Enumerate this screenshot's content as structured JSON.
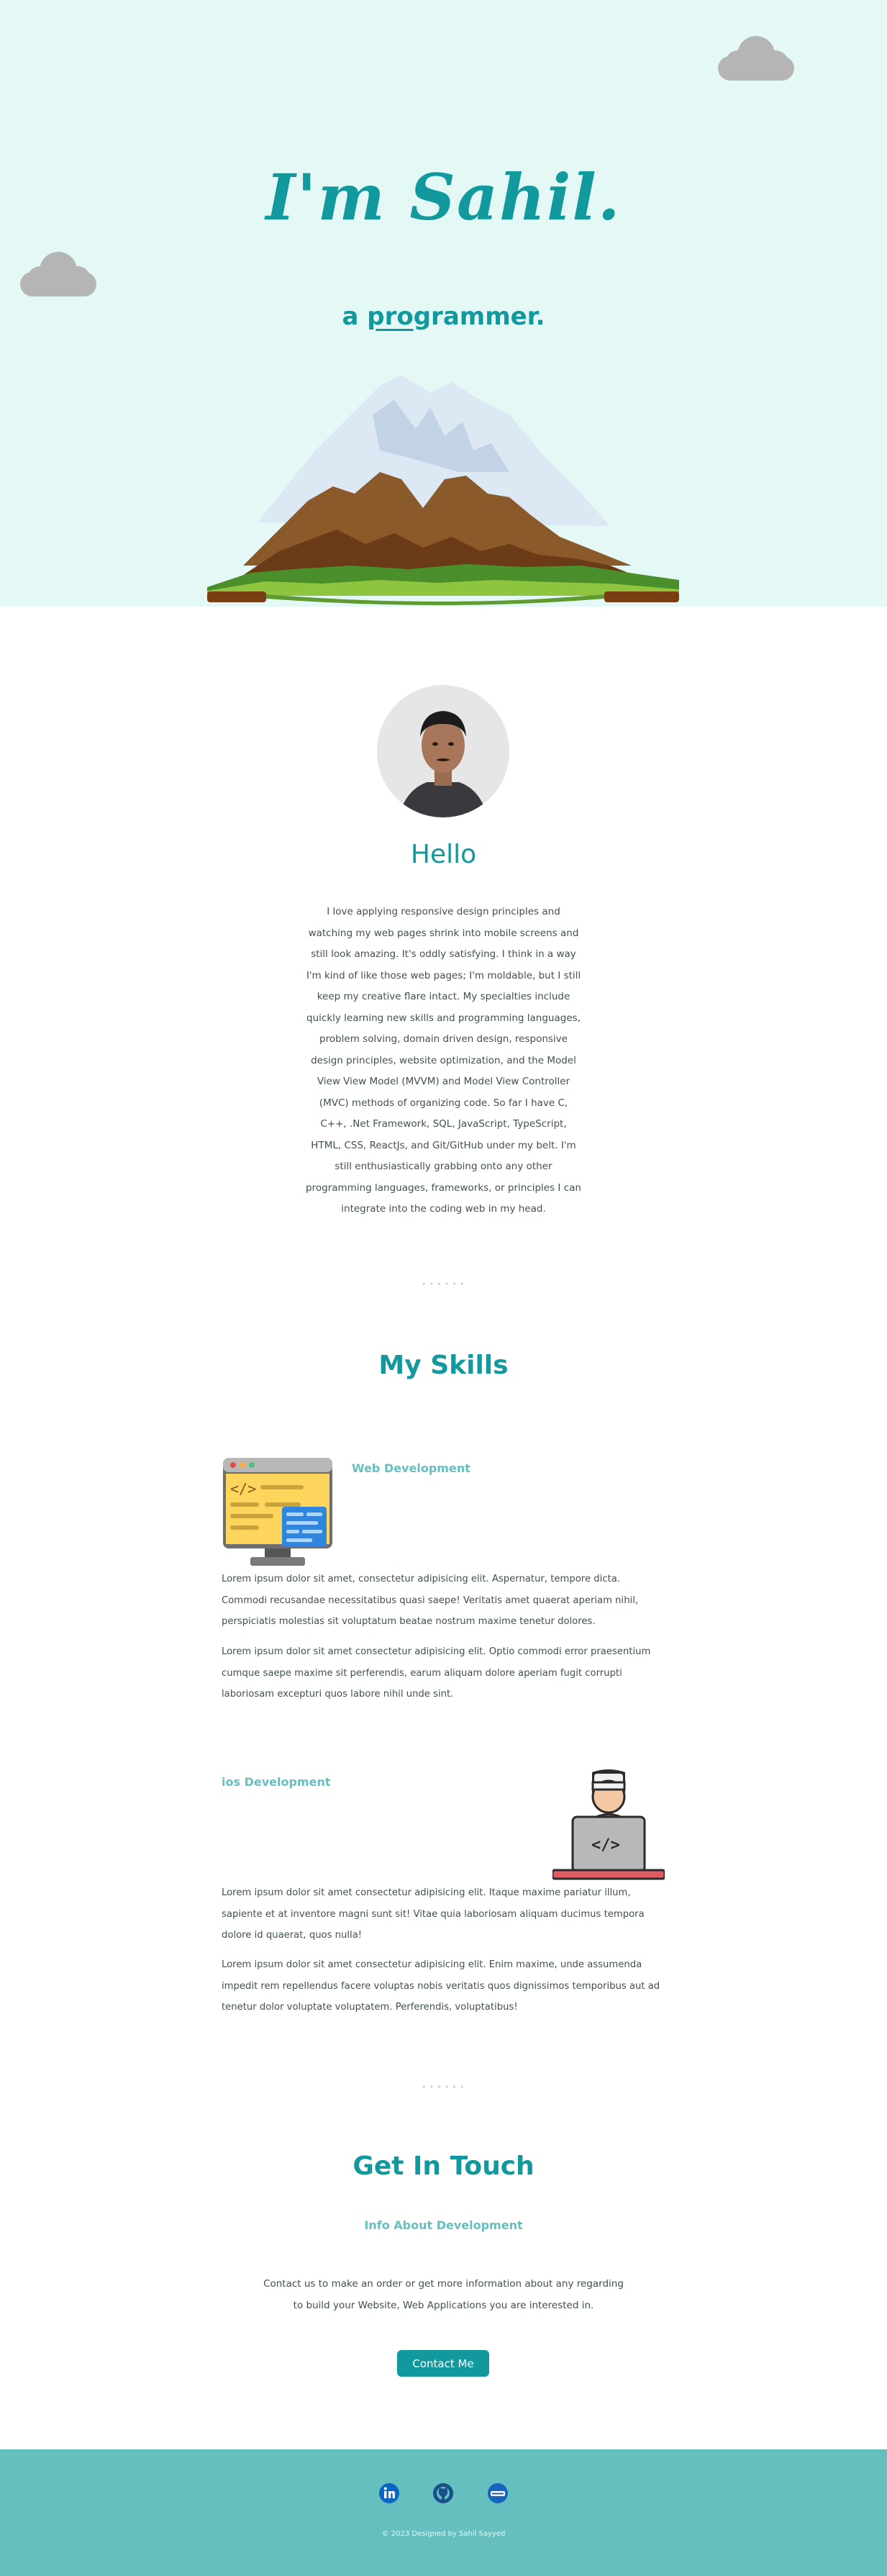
{
  "hero": {
    "title": "I'm Sahil.",
    "subtitle_prefix": "a ",
    "subtitle_underlined": "pro",
    "subtitle_rest": "grammer."
  },
  "about": {
    "heading": "Hello",
    "text": "I love applying responsive design principles and watching my web pages shrink into mobile screens and still look amazing. It's oddly satisfying. I think in a way I'm kind of like those web pages; I'm moldable, but I still keep my creative flare intact. My specialties include quickly learning new skills and programming languages, problem solving, domain driven design, responsive design principles, website optimization, and the Model View View Model (MVVM) and Model View Controller (MVC) methods of organizing code. So far I have C, C++, .Net Framework, SQL, JavaScript, TypeScript, HTML, CSS, ReactJs, and Git/GitHub under my belt. I'm still enthusiastically grabbing onto any other programming languages, frameworks, or principles I can integrate into the coding web in my head."
  },
  "skills": {
    "heading": "My Skills",
    "items": [
      {
        "title": "Web Development",
        "icon": "code-monitor-icon",
        "paragraphs": [
          "Lorem ipsum dolor sit amet, consectetur adipisicing elit. Aspernatur, tempore dicta. Commodi recusandae necessitatibus quasi saepe! Veritatis amet quaerat aperiam nihil, perspiciatis molestias sit voluptatum beatae nostrum maxime tenetur dolores.",
          "Lorem ipsum dolor sit amet consectetur adipisicing elit. Optio commodi error praesentium cumque saepe maxime sit perferendis, earum aliquam dolore aperiam fugit corrupti laboriosam excepturi quos labore nihil unde sint."
        ]
      },
      {
        "title": "ios Development",
        "icon": "programmer-laptop-icon",
        "paragraphs": [
          "Lorem ipsum dolor sit amet consectetur adipisicing elit. Itaque maxime pariatur illum, sapiente et at inventore magni sunt sit! Vitae quia laboriosam aliquam ducimus tempora dolore id quaerat, quos nulla!",
          "Lorem ipsum dolor sit amet consectetur adipisicing elit. Enim maxime, unde assumenda impedit rem repellendus facere voluptas nobis veritatis quos dignissimos temporibus aut ad tenetur dolor voluptate voluptatem. Perferendis, voluptatibus!"
        ]
      }
    ]
  },
  "contact": {
    "heading": "Get In Touch",
    "subheading": "Info About Development",
    "text": "Contact us to make an order or get more information about any regarding to build your Website, Web Applications you are interested in.",
    "button_label": "Contact Me"
  },
  "footer": {
    "social": [
      "linkedin-icon",
      "github-icon",
      "codepen-icon"
    ],
    "copyright": "© 2023 Designed by Sahil Sayyed"
  },
  "colors": {
    "hero_bg": "#e4f9f5",
    "accent": "#11999e",
    "light_accent": "#66bfbf",
    "text": "#40514e"
  }
}
